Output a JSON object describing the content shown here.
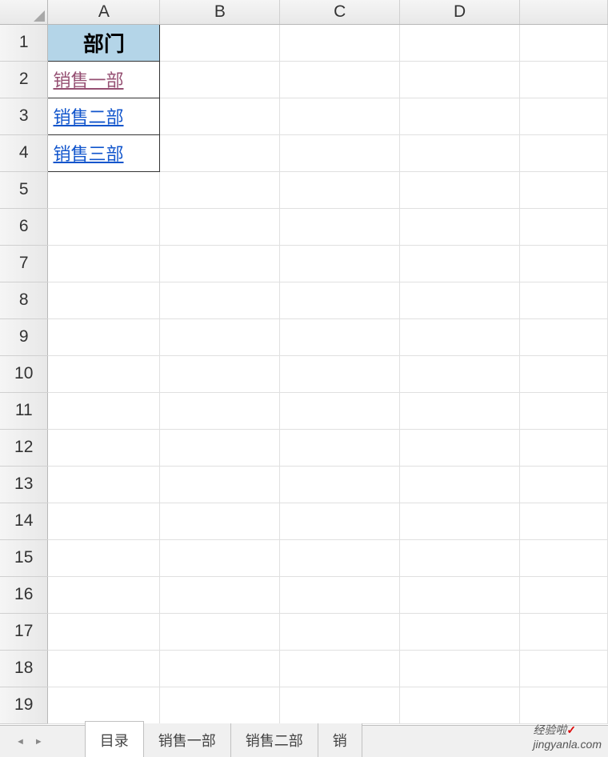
{
  "columns": [
    "A",
    "B",
    "C",
    "D",
    ""
  ],
  "rows": [
    "1",
    "2",
    "3",
    "4",
    "5",
    "6",
    "7",
    "8",
    "9",
    "10",
    "11",
    "12",
    "13",
    "14",
    "15",
    "16",
    "17",
    "18",
    "19"
  ],
  "cells": {
    "A1": "部门",
    "A2": "销售一部",
    "A3": "销售二部",
    "A4": "销售三部"
  },
  "sheetTabs": {
    "active": "目录",
    "tabs": [
      "目录",
      "销售一部",
      "销售二部",
      "销"
    ]
  },
  "watermark": {
    "text": "经验啦",
    "url": "jingyanla.com",
    "check": "✓"
  }
}
